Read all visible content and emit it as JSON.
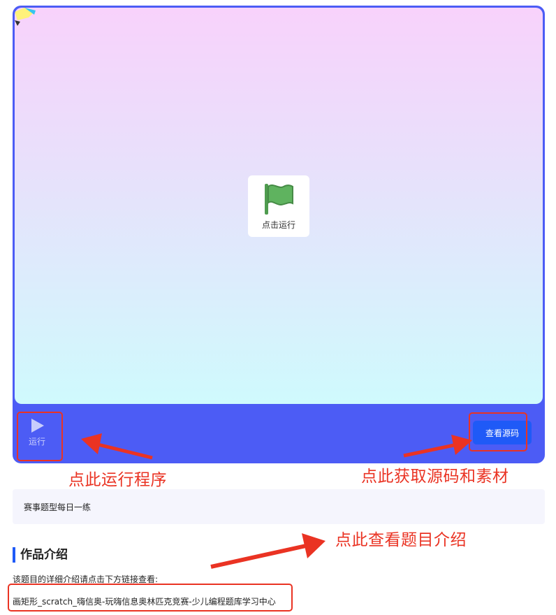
{
  "player": {
    "start_card_label": "点击运行",
    "run_label": "运行",
    "source_button_label": "查看源码"
  },
  "annotations": {
    "run_hint": "点此运行程序",
    "source_hint": "点此获取源码和素材",
    "intro_hint": "点此查看题目介绍",
    "color": "#ea3323"
  },
  "tag_panel": {
    "text": "赛事题型每日一练"
  },
  "intro": {
    "title": "作品介绍",
    "description": "该题目的详细介绍请点击下方链接查看:",
    "link_text": "画矩形_scratch_嗨信奥-玩嗨信息奥林匹克竞赛-少儿编程题库学习中心"
  },
  "icons": {
    "flag": "green-flag-icon",
    "play": "play-icon",
    "corner": "pencil-sprite-icon"
  },
  "colors": {
    "player_bg": "#4c5cf5",
    "button_blue": "#1f5af7",
    "flag_green": "#5fb35f"
  }
}
